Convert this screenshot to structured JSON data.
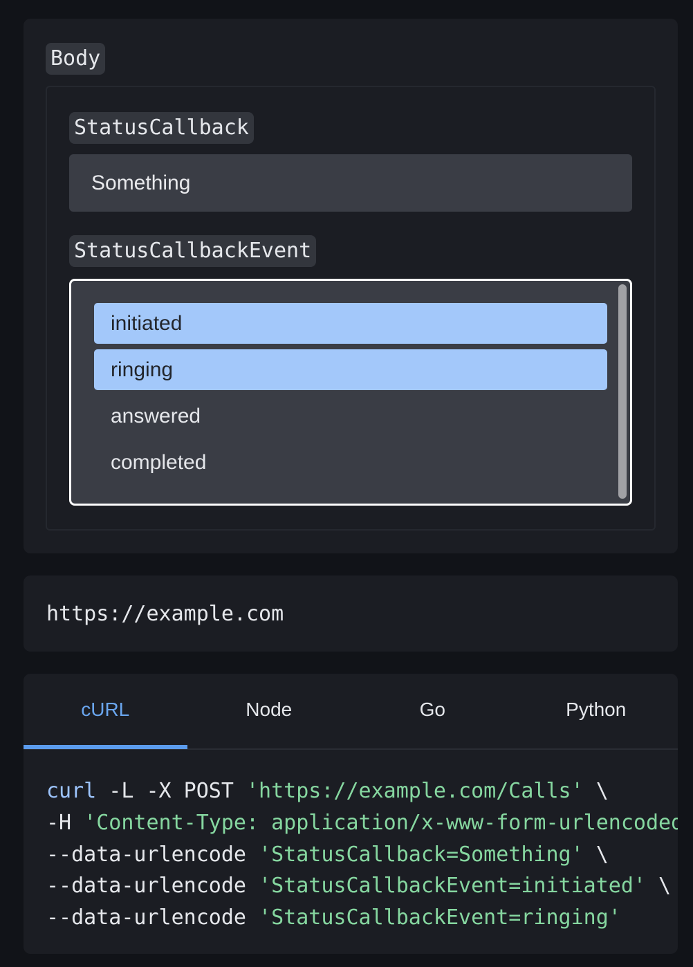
{
  "body_section": {
    "label": "Body",
    "fields": {
      "status_callback": {
        "label": "StatusCallback",
        "value": "Something"
      },
      "status_callback_event": {
        "label": "StatusCallbackEvent",
        "options": [
          {
            "label": "initiated",
            "selected": true
          },
          {
            "label": "ringing",
            "selected": true
          },
          {
            "label": "answered",
            "selected": false
          },
          {
            "label": "completed",
            "selected": false
          }
        ]
      }
    }
  },
  "url_panel": {
    "url": "https://example.com"
  },
  "code_panel": {
    "tabs": [
      {
        "label": "cURL",
        "active": true
      },
      {
        "label": "Node",
        "active": false
      },
      {
        "label": "Go",
        "active": false
      },
      {
        "label": "Python",
        "active": false
      }
    ],
    "lines": [
      {
        "cmd": "curl",
        "flags": " -L -X POST ",
        "arg": "'https://example.com/Calls'",
        "tail": " \\"
      },
      {
        "cmd": "",
        "flags": "-H ",
        "arg": "'Content-Type: application/x-www-form-urlencoded'",
        "tail": " \\"
      },
      {
        "cmd": "",
        "flags": "--data-urlencode ",
        "arg": "'StatusCallback=Something'",
        "tail": " \\"
      },
      {
        "cmd": "",
        "flags": "--data-urlencode ",
        "arg": "'StatusCallbackEvent=initiated'",
        "tail": " \\"
      },
      {
        "cmd": "",
        "flags": "--data-urlencode ",
        "arg": "'StatusCallbackEvent=ringing'",
        "tail": ""
      }
    ],
    "colors": {
      "command": "#9cc3fb",
      "string": "#86d7a0",
      "active_tab": "#6aa6ef"
    }
  }
}
